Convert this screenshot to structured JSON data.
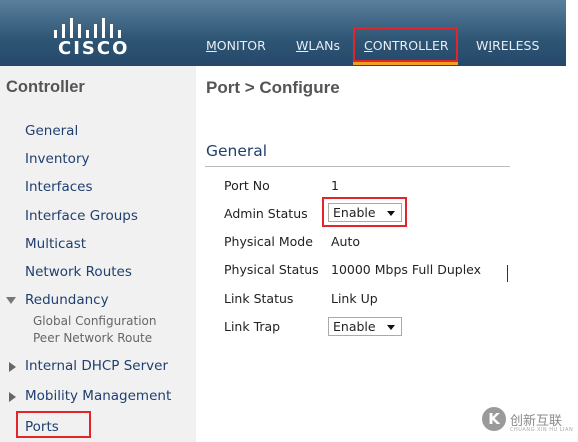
{
  "header": {
    "logo_text": "CISCO",
    "nav": {
      "monitor": {
        "accel": "M",
        "rest": "ONITOR"
      },
      "wlans": {
        "accel": "W",
        "rest": "LANs"
      },
      "controller": {
        "accel": "C",
        "rest": "ONTROLLER"
      },
      "wireless": {
        "pre": "W",
        "accel": "I",
        "rest": "RELESS"
      }
    },
    "active_tab": "CONTROLLER",
    "highlight_color": "#e2252b"
  },
  "sidebar": {
    "title": "Controller",
    "items": {
      "general": "General",
      "inventory": "Inventory",
      "interfaces": "Interfaces",
      "interface_groups": "Interface Groups",
      "multicast": "Multicast",
      "network_routes": "Network Routes",
      "redundancy": "Redundancy",
      "global_configuration": "Global Configuration",
      "peer_network_route": "Peer Network Route",
      "internal_dhcp_server": "Internal DHCP Server",
      "mobility_management": "Mobility Management",
      "ports": "Ports"
    }
  },
  "main": {
    "page_title": "Port > Configure",
    "section_title": "General",
    "fields": {
      "port_no": {
        "label": "Port No",
        "value": "1"
      },
      "admin_status": {
        "label": "Admin Status",
        "value": "Enable"
      },
      "physical_mode": {
        "label": "Physical Mode",
        "value": "Auto"
      },
      "physical_status": {
        "label": "Physical Status",
        "value": "10000 Mbps Full Duplex"
      },
      "link_status": {
        "label": "Link Status",
        "value": "Link Up"
      },
      "link_trap": {
        "label": "Link Trap",
        "value": "Enable"
      }
    }
  },
  "watermark": {
    "icon": "K",
    "text": "创新互联",
    "subtext": "CHUANG XIN HU LIAN"
  }
}
